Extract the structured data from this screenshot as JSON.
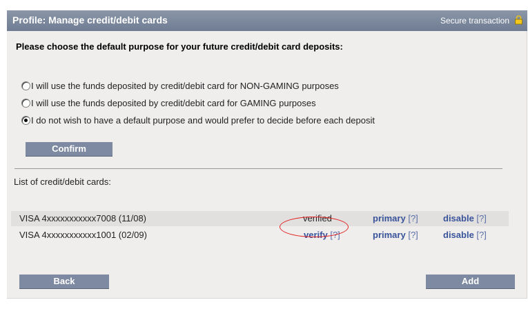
{
  "header": {
    "title": "Profile: Manage credit/debit cards",
    "secure_label": "Secure transaction"
  },
  "purpose": {
    "question": "Please choose the default purpose for your future credit/debit card deposits:",
    "options": [
      {
        "label": "I will use the funds deposited by credit/debit card for NON-GAMING purposes",
        "checked": false
      },
      {
        "label": "I will use the funds deposited by credit/debit card for GAMING purposes",
        "checked": false
      },
      {
        "label": "I do not wish to have a default purpose and would prefer to decide before each deposit",
        "checked": true
      }
    ],
    "confirm_label": "Confirm"
  },
  "cards": {
    "list_label": "List of credit/debit cards:",
    "rows": [
      {
        "name": "VISA 4xxxxxxxxxxx7008 (11/08)",
        "status": "verified",
        "status_is_link": false,
        "primary": "primary",
        "disable": "disable",
        "help": "[?]"
      },
      {
        "name": "VISA 4xxxxxxxxxxx1001 (02/09)",
        "status": "verify",
        "status_is_link": true,
        "primary": "primary",
        "disable": "disable",
        "help": "[?]"
      }
    ]
  },
  "footer": {
    "back_label": "Back",
    "add_label": "Add"
  },
  "colors": {
    "titlebar": "#7b879c",
    "button": "#7e8aa1",
    "link": "#39539b",
    "highlight": "#e02020"
  },
  "icons": {
    "lock": "lock-icon"
  }
}
